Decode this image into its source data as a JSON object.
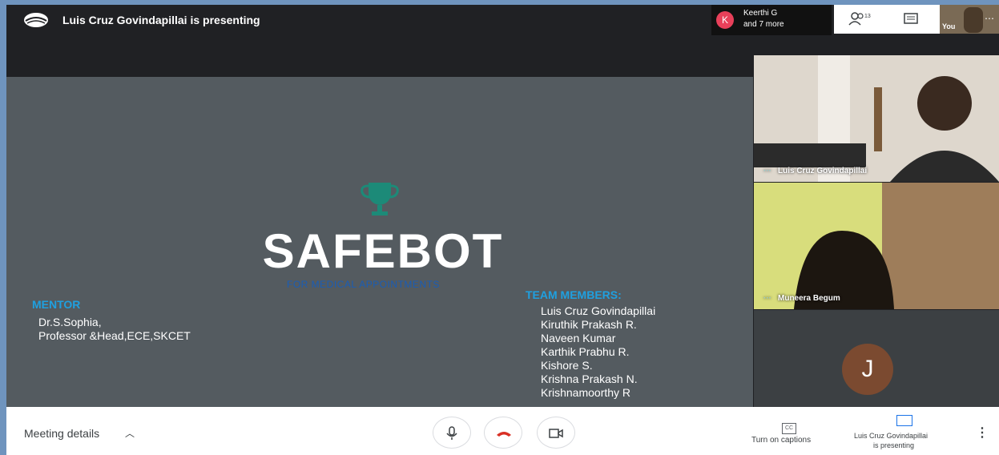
{
  "topbar": {
    "presenting_text": "Luis Cruz Govindapillai is presenting",
    "raise": {
      "initial": "K",
      "name": "Keerthi G",
      "more": "and 7 more"
    },
    "people_count": "13",
    "you_label": "You"
  },
  "slide": {
    "title": "SAFEBOT",
    "subtitle": "FOR MEDICAL APPOINTMENTS",
    "mentor_heading": "MENTOR",
    "mentor_name": "Dr.S.Sophia,",
    "mentor_role": "Professor &Head,ECE,SKCET",
    "team_heading": "TEAM MEMBERS:",
    "team_members": [
      "Luis Cruz Govindapillai",
      "Kiruthik Prakash R.",
      "Naveen Kumar",
      "Karthik Prabhu R.",
      "Kishore S.",
      "Krishna Prakash N.",
      "Krishnamoorthy R"
    ]
  },
  "tiles": [
    {
      "name": "Luis Cruz Govindapillai"
    },
    {
      "name": "Muneera Begum"
    },
    {
      "initial": "J"
    }
  ],
  "bottombar": {
    "meeting_details": "Meeting details",
    "captions": "Turn on captions",
    "presenting_line1": "Luis Cruz Govindapillai",
    "presenting_line2": "is presenting"
  },
  "colors": {
    "accent": "#1fa0e0",
    "end_call": "#d93025",
    "slide_bg": "#545b60"
  },
  "icons": [
    "present-icon",
    "people-icon",
    "chat-icon",
    "trophy-icon",
    "mic-icon",
    "end-call-icon",
    "camera-icon",
    "captions-icon",
    "present-screen-icon",
    "more-icon",
    "chevron-up-icon"
  ]
}
